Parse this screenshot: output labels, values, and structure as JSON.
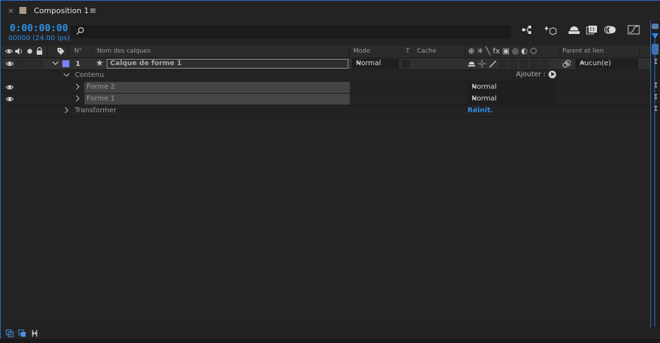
{
  "tab": {
    "close": "×",
    "title": "Composition 1",
    "menu": "≡",
    "swatch_color": "#a89a86"
  },
  "timecode": {
    "time": "0:00:00:00",
    "frames": "00000 (24.00 ips)"
  },
  "search": {
    "icon": "search-icon",
    "glyph": "⌕",
    "value": ""
  },
  "toolbar_icons": [
    "composition-flowchart-icon",
    "draft-3d-icon",
    "shy-layers-icon",
    "frame-blending-icon",
    "motion-blur-icon",
    "graph-editor-icon"
  ],
  "columns": {
    "eye": "👁",
    "num": "N°",
    "name": "Nom des calques",
    "mode": "Mode",
    "t": "T",
    "cache": "Cache",
    "switches": "⊕ ✳ ╲ fx ▣ ◎ ◐ ⬡",
    "parent": "Parent et lien"
  },
  "layer": {
    "number": "1",
    "name": "Calque de forme 1",
    "label_color": "#7f7fff",
    "mode": "Normal",
    "parent": "Aucun(e)",
    "star": "★"
  },
  "contents": {
    "label": "Contenu",
    "add_label": "Ajouter :"
  },
  "shapes": [
    {
      "name": "Forme 2",
      "mode": "Normal"
    },
    {
      "name": "Forme 1",
      "mode": "Normal"
    }
  ],
  "transform": {
    "label": "Transformer",
    "reset": "Réinit."
  },
  "colors": {
    "accent": "#2e8ee6",
    "panel_border": "#2d6ed0"
  }
}
